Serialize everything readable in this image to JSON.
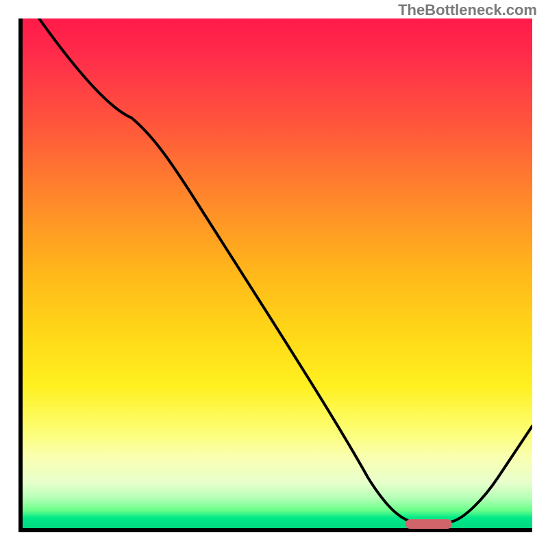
{
  "watermark": "TheBottleneck.com",
  "chart_data": {
    "type": "line",
    "title": "",
    "xlabel": "",
    "ylabel": "",
    "xlim": [
      0,
      100
    ],
    "ylim": [
      0,
      100
    ],
    "curve": [
      {
        "x": 4,
        "y": 100
      },
      {
        "x": 22,
        "y": 81
      },
      {
        "x": 26,
        "y": 76
      },
      {
        "x": 30,
        "y": 69
      },
      {
        "x": 68,
        "y": 10
      },
      {
        "x": 72,
        "y": 4
      },
      {
        "x": 76,
        "y": 1.5
      },
      {
        "x": 80,
        "y": 1.5
      },
      {
        "x": 84,
        "y": 1.5
      },
      {
        "x": 88,
        "y": 5
      },
      {
        "x": 100,
        "y": 21
      }
    ],
    "marker_segment": {
      "x_start": 75,
      "x_end": 85,
      "y": 1.5,
      "color": "#d1646b"
    },
    "gradient_stops": [
      {
        "pos": 0,
        "color": "#ff1a4a"
      },
      {
        "pos": 50,
        "color": "#ffb81a"
      },
      {
        "pos": 80,
        "color": "#fdfd6a"
      },
      {
        "pos": 100,
        "color": "#00d880"
      }
    ]
  }
}
